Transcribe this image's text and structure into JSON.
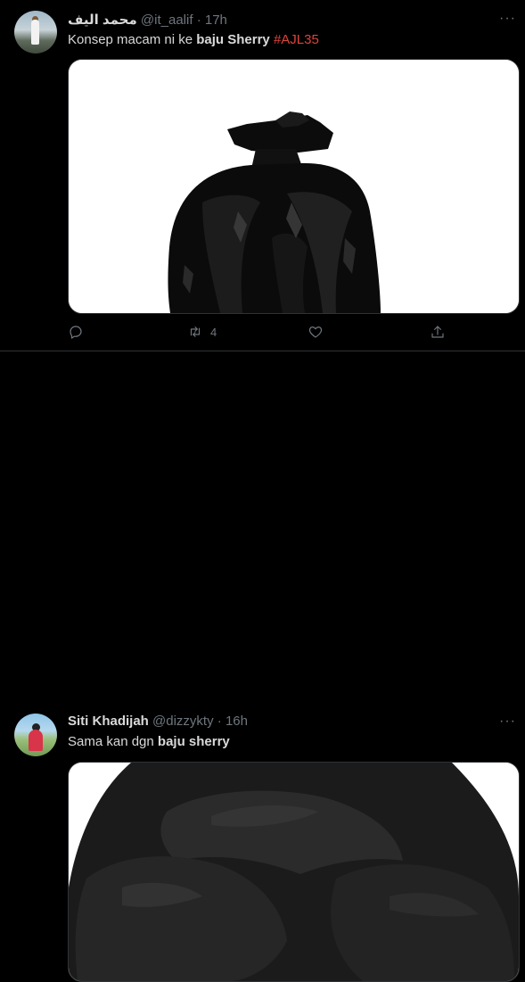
{
  "tweets": [
    {
      "name": "محمد اليف",
      "handle": "@it_aalif",
      "time": "17h",
      "text_plain": "Konsep macam ni ke ",
      "text_bold": "baju Sherry",
      "hashtag": "#AJL35",
      "media_subject": "black garbage bag",
      "actions": {
        "retweet_count": "4"
      }
    },
    {
      "name": "Siti Khadijah",
      "handle": "@dizzykty",
      "time": "16h",
      "text_plain": "Sama kan dgn ",
      "text_bold": "baju sherry",
      "media_subject": "black bean bag"
    }
  ],
  "ui": {
    "separator_dot": "·",
    "more_glyph": "···"
  },
  "colors": {
    "background": "#000000",
    "text": "#d9d9d9",
    "muted": "#6e767d",
    "hashtag": "#e0433b",
    "border": "#2f3336"
  }
}
